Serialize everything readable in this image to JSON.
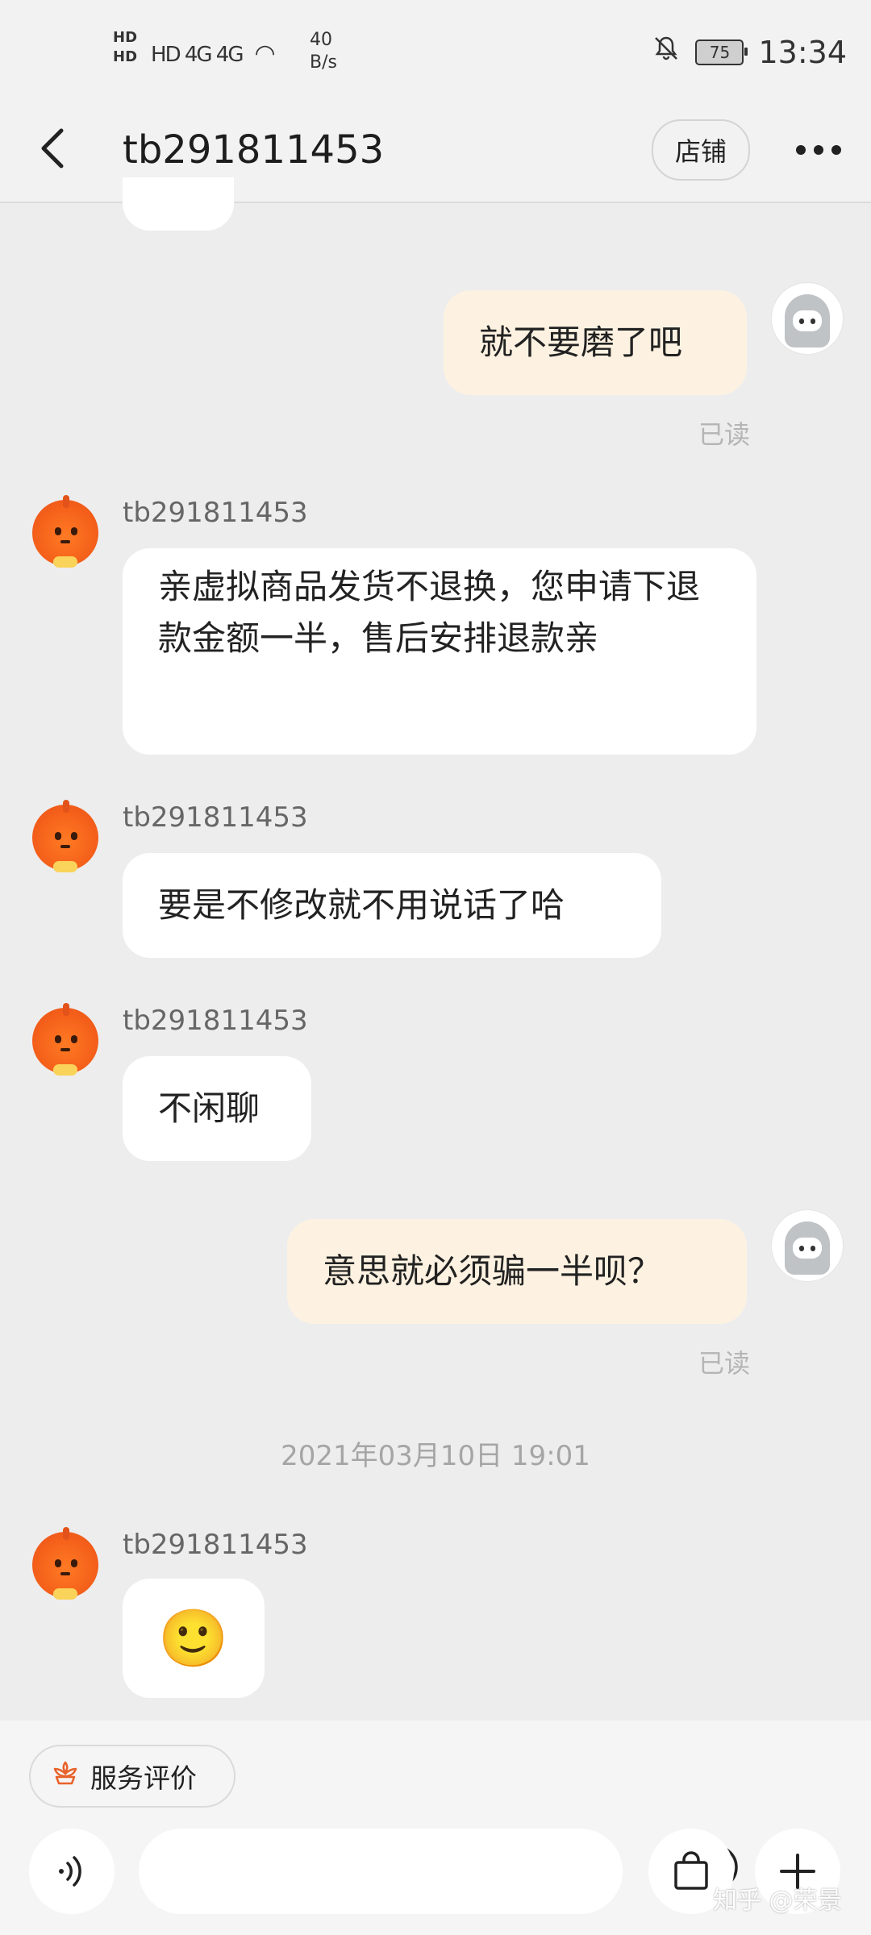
{
  "status_bar": {
    "network_left": "HD 4G 4G",
    "speed_value": "40",
    "speed_unit": "B/s",
    "battery": "75",
    "time": "13:34",
    "icons": [
      "hd-icon",
      "signal-icon",
      "wifi-icon",
      "bell-off-icon",
      "battery-icon"
    ]
  },
  "nav": {
    "title": "tb291811453",
    "shop_label": "店铺",
    "back_icon": "chevron-left-icon",
    "more_icon": "more-dots-icon"
  },
  "messages": [
    {
      "from": "self",
      "text": "就不要磨了吧",
      "status": "已读"
    },
    {
      "from": "shop",
      "sender": "tb291811453",
      "text": "亲虚拟商品发货不退换，您申请下退款金额一半，售后安排退款亲"
    },
    {
      "from": "shop",
      "sender": "tb291811453",
      "text": "要是不修改就不用说话了哈"
    },
    {
      "from": "shop",
      "sender": "tb291811453",
      "text": "不闲聊"
    },
    {
      "from": "self",
      "text": "意思就必须骗一半呗？",
      "status": "已读"
    },
    {
      "timestamp": "2021年03月10日 19:01"
    },
    {
      "from": "shop",
      "sender": "tb291811453",
      "text": "🙂"
    }
  ],
  "bottom": {
    "service_label": "服务评价",
    "service_icon": "flower-icon",
    "voice_icon": "voice-icon",
    "emoji_icon": "smile-icon",
    "bag_icon": "shopping-bag-icon",
    "plus_icon": "plus-icon"
  },
  "watermark": "知乎 @荣景",
  "colors": {
    "background": "#ededed",
    "self_bubble": "#fdf2e1",
    "shop_bubble": "#ffffff",
    "accent": "#f4601a"
  }
}
